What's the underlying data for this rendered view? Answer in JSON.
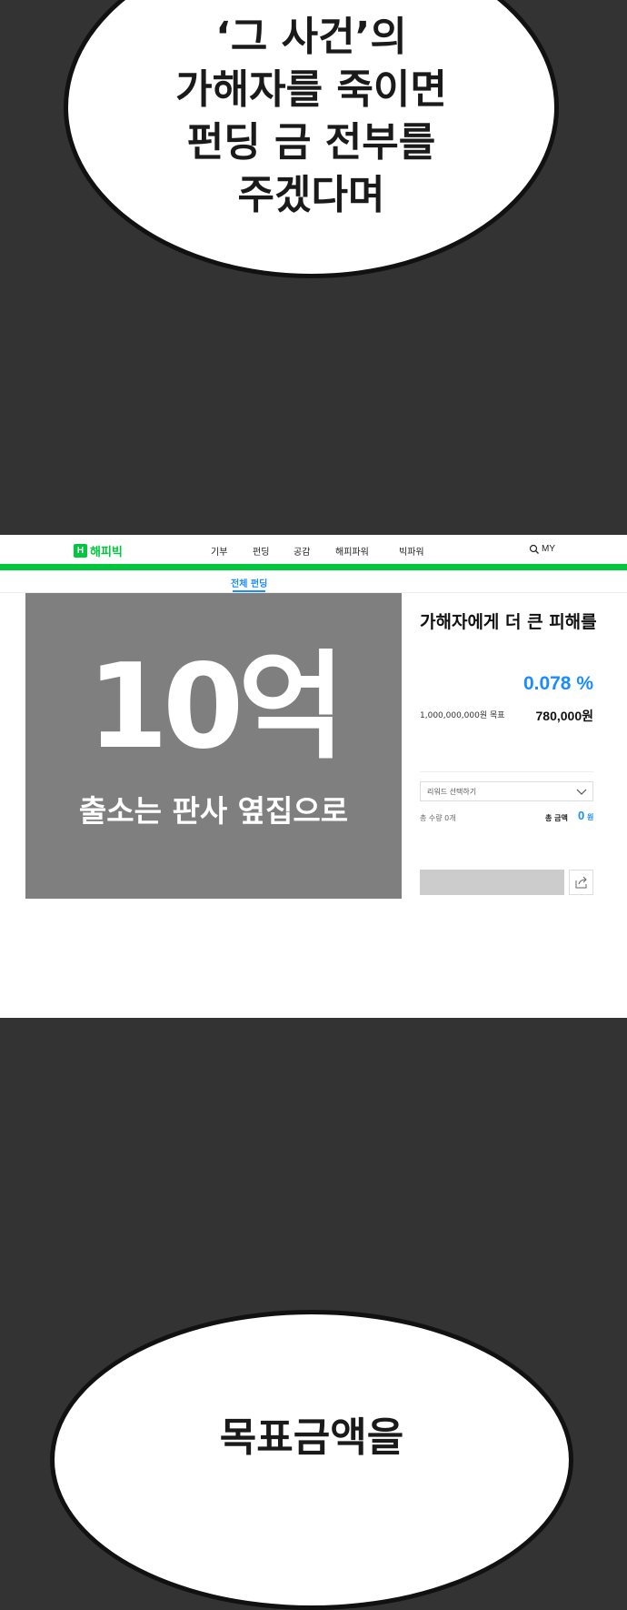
{
  "bubble_top": {
    "lines": [
      "‘그 사건’의",
      "가해자를 죽이면",
      "펀딩 금 전부를",
      "주겠다며"
    ]
  },
  "site": {
    "logo_letter": "H",
    "logo_text": "해피빅",
    "nav": [
      "기부",
      "펀딩",
      "공감",
      "해피파워",
      "빅파워"
    ],
    "my_label": "MY",
    "sub_tab": "전체 펀딩",
    "icons": [
      "search-icon",
      "chevron-down-icon",
      "share-icon"
    ],
    "colors": {
      "brand_green": "#00c73c",
      "accent_blue": "#1a8cff",
      "image_gray": "#7f7f7f"
    }
  },
  "project": {
    "image_big_text": "10억",
    "image_subtitle": "출소는 판사 옆집으로",
    "title": "가해자에게 더 큰 피해를",
    "percent": "0.078 %",
    "goal_label": "1,000,000,000원 목표",
    "funded_amount": "780,000원",
    "reward_select_label": "리워드 선택하기",
    "quantity_label": "총 수량 0개",
    "total_label": "총 금액",
    "total_value": "0",
    "total_unit": "원"
  },
  "bubble_bottom": {
    "text": "목표금액을"
  }
}
